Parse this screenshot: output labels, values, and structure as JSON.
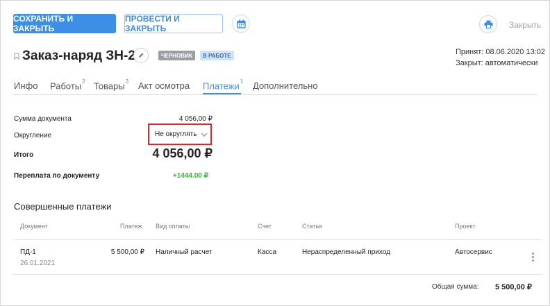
{
  "toolbar": {
    "save_close_label": "СОХРАНИТЬ И ЗАКРЫТЬ",
    "post_close_label": "ПРОВЕСТИ И ЗАКРЫТЬ",
    "calendar_icon": "calendar-icon",
    "print_icon": "printer-icon",
    "close_label": "Закрыть"
  },
  "document": {
    "title": "Заказ-наряд ЗН-2",
    "badge_draft": "ЧЕРНОВИК",
    "badge_in_work": "В РАБОТЕ",
    "accepted": "Принят: 08.06.2020 13:02",
    "closed": "Закрыт: автоматически"
  },
  "tabs": [
    {
      "label": "Инфо",
      "count": ""
    },
    {
      "label": "Работы",
      "count": "2"
    },
    {
      "label": "Товары",
      "count": "3"
    },
    {
      "label": "Акт осмотра",
      "count": ""
    },
    {
      "label": "Платежи",
      "count": "1"
    },
    {
      "label": "Дополнительно",
      "count": ""
    }
  ],
  "summary": {
    "doc_sum_label": "Сумма документа",
    "doc_sum_value": "4 056,00 ₽",
    "rounding_label": "Округление",
    "rounding_value": "Не округлять",
    "total_label": "Итого",
    "total_value": "4 056,00 ₽",
    "overpay_label": "Переплата по документу",
    "overpay_value": "+1444.00 ₽"
  },
  "payments": {
    "title": "Совершенные платежи",
    "columns": [
      "Документ",
      "Платеж",
      "Вид оплаты",
      "Счет",
      "Статья",
      "Проект"
    ],
    "rows": [
      {
        "doc": "ПД-1",
        "date": "26.01.2021",
        "amount": "5 500,00 ₽",
        "pay_type": "Наличный расчет",
        "account": "Касса",
        "article": "Нераспределенный приход",
        "project": "Автосервис"
      }
    ],
    "total_label": "Общая сумма:",
    "total_value": "5 500,00 ₽"
  },
  "colors": {
    "accent": "#3d8fe5",
    "positive": "#2eb82e",
    "highlight": "#e0262c"
  }
}
